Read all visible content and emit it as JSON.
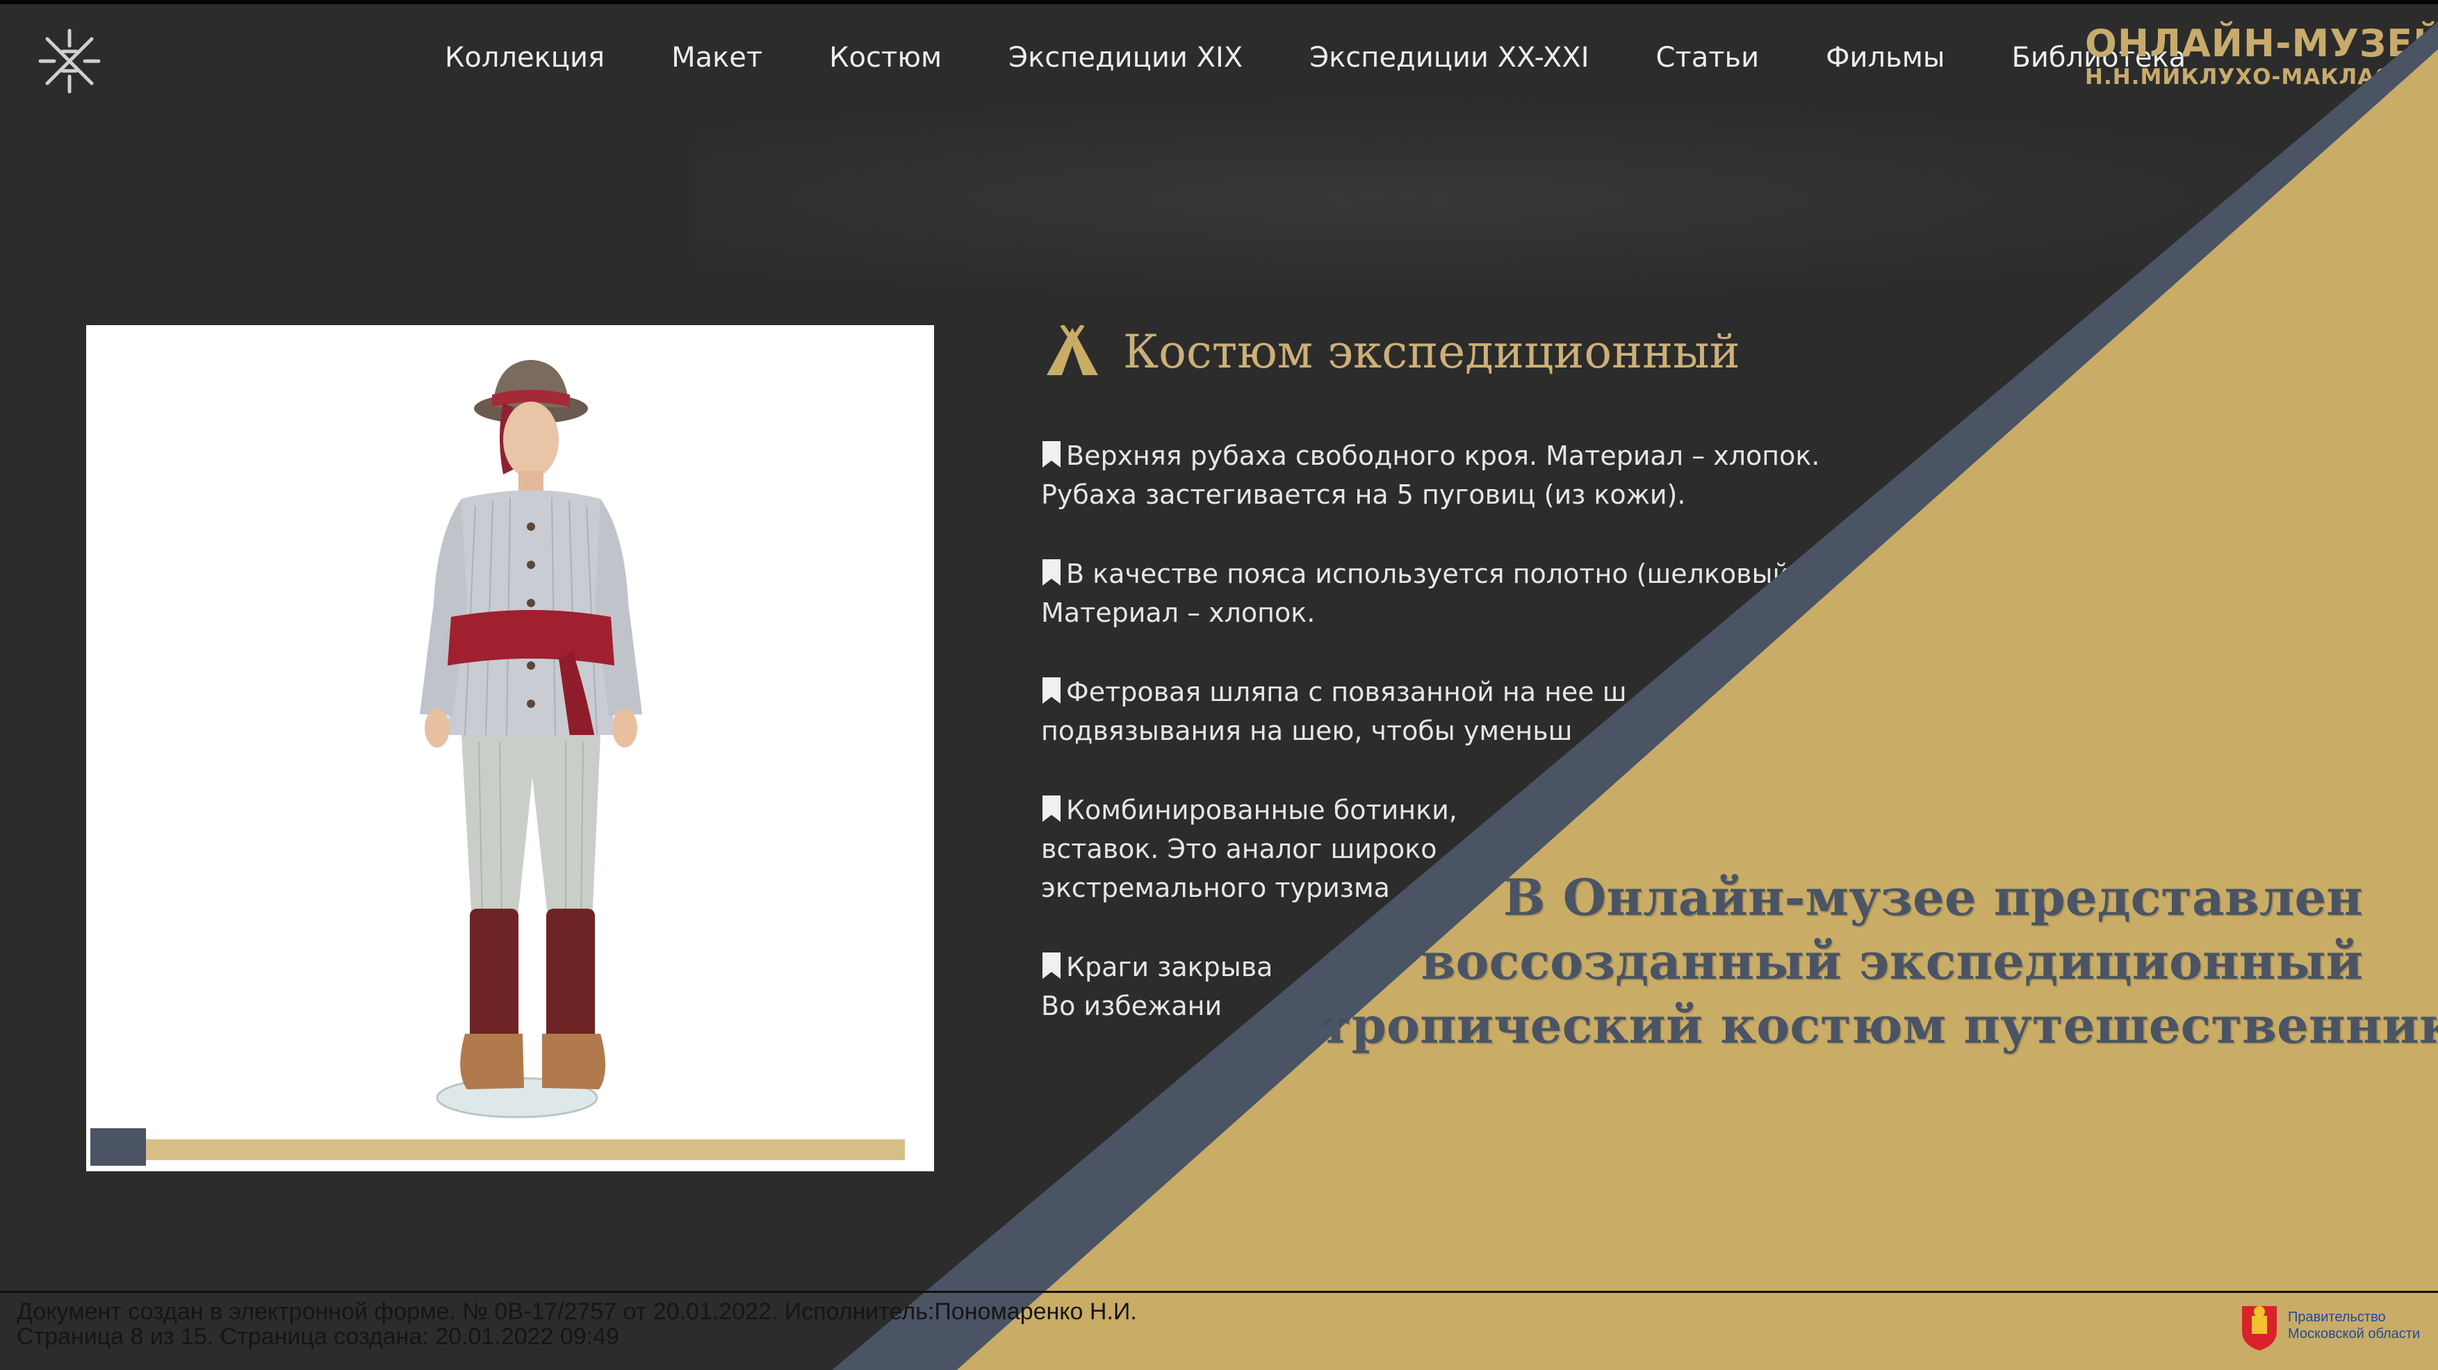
{
  "nav": {
    "items": [
      {
        "label": "Коллекция"
      },
      {
        "label": "Макет"
      },
      {
        "label": "Костюм"
      },
      {
        "label": "Экспедиции XIX"
      },
      {
        "label": "Экспедиции XX-XXI"
      },
      {
        "label": "Статьи"
      },
      {
        "label": "Фильмы"
      },
      {
        "label": "Библиотека"
      }
    ]
  },
  "brand": {
    "line1": "ОНЛАЙН-МУЗЕЙ",
    "line2": "Н.Н.МИКЛУХО-МАКЛАЯ"
  },
  "gallery": {
    "progress": 0.06
  },
  "description": {
    "title": "Костюм экспедиционный",
    "bullets": [
      {
        "line1": "Верхняя рубаха свободного кроя. Материал – хлопок.",
        "line2": "Рубаха застегивается на 5 пуговиц (из кожи)."
      },
      {
        "line1": "В качестве пояса используется полотно (шелковый",
        "line2": "Материал – хлопок."
      },
      {
        "line1": "Фетровая шляпа с повязанной на нее ш",
        "line2": "подвязывания на шею, чтобы уменьш"
      },
      {
        "line1": "Комбинированные ботинки, ",
        "line2": "вставок. Это аналог широко",
        "line3": "экстремального туризма"
      },
      {
        "line1": "Краги закрыва",
        "line2": "Во избежани"
      }
    ]
  },
  "promo": {
    "line1": "В Онлайн-музее представлен",
    "line2": "воссозданный экспедиционный",
    "line3": "тропический костюм путешественника"
  },
  "footer": {
    "line1": "Документ создан в электронной форме. № 0В-17/2757 от 20.01.2022. Исполнитель:Пономаренко Н.И.",
    "line2": "Страница 8 из 15. Страница создана: 20.01.2022 09:49",
    "gov_line1": "Правительство",
    "gov_line2": "Московской области"
  },
  "colors": {
    "background": "#2c2c2c",
    "gold": "#c9ac66",
    "slate": "#4a5465",
    "title_gold": "#cdb077"
  },
  "icons": {
    "logo": "ornament-icon",
    "title": "tent-icon",
    "bullet": "bookmark-icon"
  }
}
